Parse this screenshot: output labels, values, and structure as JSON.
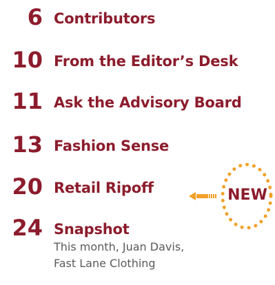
{
  "entries": [
    {
      "number": "6",
      "title": "Contributors"
    },
    {
      "number": "10",
      "title": "From the Editor’s Desk"
    },
    {
      "number": "11",
      "title": "Ask the Advisory Board"
    },
    {
      "number": "13",
      "title": "Fashion Sense"
    },
    {
      "number": "20",
      "title": "Retail Ripoff"
    },
    {
      "number": "24",
      "title": "Snapshot",
      "description_lines": [
        "This month, Juan Davis,",
        "Fast Lane Clothing"
      ]
    }
  ],
  "badge": {
    "label": "NEW",
    "icon": "arrow-left-icon",
    "color": "#f2a12a"
  },
  "colors": {
    "accent": "#8c1c2c",
    "text": "#5a5a5a"
  }
}
